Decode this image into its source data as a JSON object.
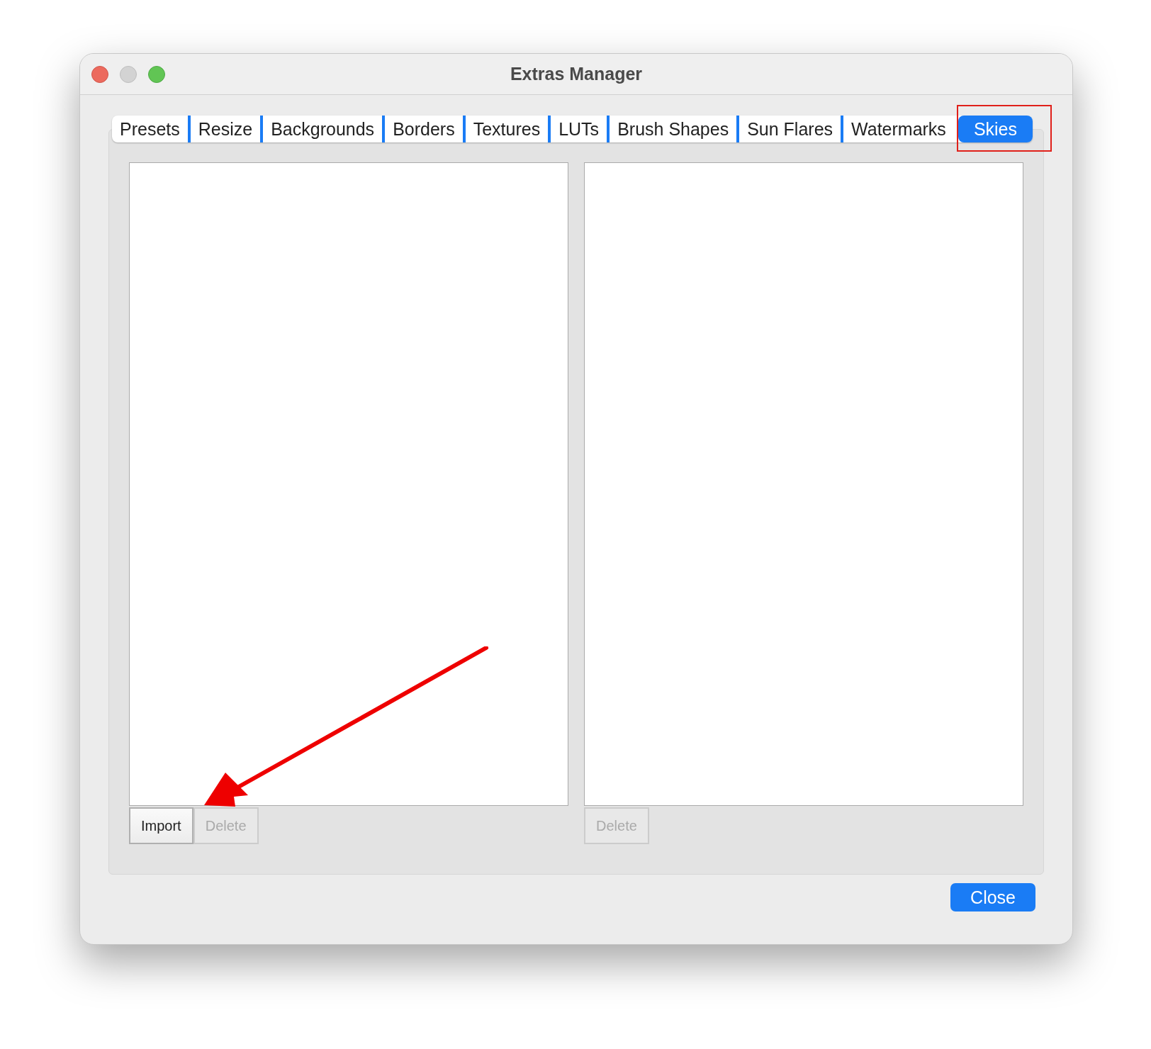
{
  "window": {
    "title": "Extras Manager"
  },
  "tabs": [
    {
      "label": "Presets",
      "selected": false
    },
    {
      "label": "Resize",
      "selected": false
    },
    {
      "label": "Backgrounds",
      "selected": false
    },
    {
      "label": "Borders",
      "selected": false
    },
    {
      "label": "Textures",
      "selected": false
    },
    {
      "label": "LUTs",
      "selected": false
    },
    {
      "label": "Brush Shapes",
      "selected": false
    },
    {
      "label": "Sun Flares",
      "selected": false
    },
    {
      "label": "Watermarks",
      "selected": false
    },
    {
      "label": "Skies",
      "selected": true
    }
  ],
  "panes": [
    {
      "buttons": [
        {
          "label": "Import",
          "disabled": false
        },
        {
          "label": "Delete",
          "disabled": true
        }
      ]
    },
    {
      "buttons": [
        {
          "label": "Delete",
          "disabled": true
        }
      ]
    }
  ],
  "close_button": {
    "label": "Close"
  }
}
